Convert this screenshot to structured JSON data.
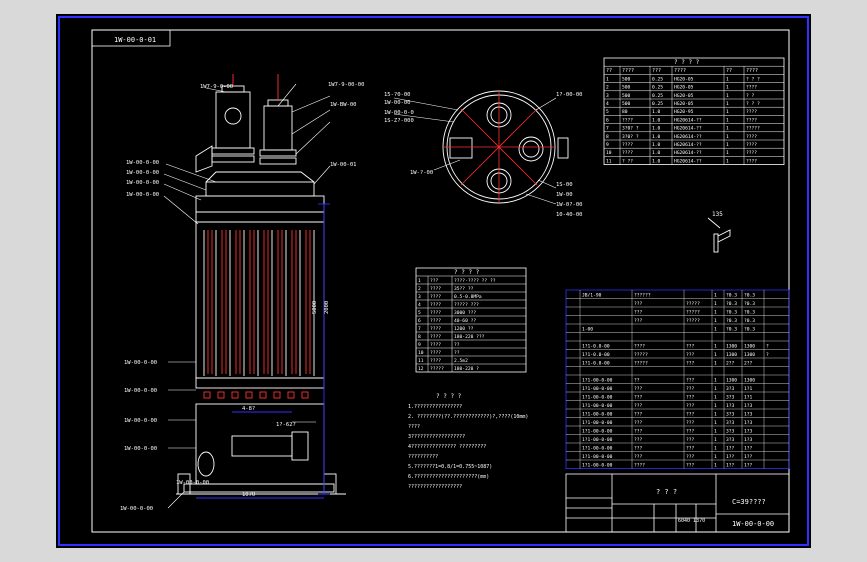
{
  "drawing": {
    "drawing_no_top": "1W-00-0-01",
    "drawing_no_bottom": "1W-00-0-00",
    "scale_label": "C=39????",
    "title_block_heading": "? ? ?",
    "small_box_label": "6040 1370",
    "view_label": "135"
  },
  "colors": {
    "background": "#000000",
    "frame": "#3030ff",
    "line": "#ffffff",
    "accent": "#ff3030",
    "dim": "#3030ff",
    "text": "#ffffff",
    "page": "#d9d9d9"
  },
  "side_view": {
    "labels": [
      "1W-00-0-00",
      "1W-00-0-00",
      "1W-00-0-00",
      "1W-00-0-00",
      "1W-00-0-00",
      "1W-00-0-00",
      "1W-00-0-00",
      "1W-00-0-00",
      "1W-00-0-00",
      "1W-00-0-00"
    ],
    "top_callouts": [
      "1W7-9-0-00",
      "1W7-9-00-00",
      "1W-BW-00",
      "1W-00-01"
    ],
    "dims": [
      "5000",
      "1070",
      "4-8?",
      "1?-62?",
      "2000"
    ]
  },
  "top_view": {
    "callouts": [
      "15-?0-00",
      "1W-00-00",
      "1W-00-0-0",
      "1S-Z?-000",
      "1?-00-00",
      "1W-?-00",
      "1S-00",
      "1W-00",
      "1W-0?-00",
      "10-40-00"
    ]
  },
  "nozzle_table": {
    "heading": "? ? ? ?",
    "columns": [
      "??",
      "????",
      "???",
      "????",
      "??",
      "????"
    ],
    "rows": [
      [
        "1",
        "500",
        "0.25",
        "HG20-05",
        "1",
        "? ? ?"
      ],
      [
        "2",
        "500",
        "0.25",
        "HG20-05",
        "1",
        "????"
      ],
      [
        "3",
        "500",
        "0.25",
        "HG20-05",
        "1",
        "? ?"
      ],
      [
        "4",
        "500",
        "0.25",
        "HG20-05",
        "1",
        "? ? ?"
      ],
      [
        "5",
        "80",
        "1.0",
        "HG20-95",
        "1",
        "????"
      ],
      [
        "6",
        "????",
        "1.0",
        "HG20614-??",
        "1",
        "????"
      ],
      [
        "7",
        "3?0? ?",
        "1.0",
        "HG20614-??",
        "1",
        "?????"
      ],
      [
        "8",
        "3?0? ?",
        "1.0",
        "HG20614-??",
        "1",
        "????"
      ],
      [
        "9",
        "????",
        "1.0",
        "HG20614-??",
        "1",
        "????"
      ],
      [
        "10",
        "????",
        "1.0",
        "HG20614-??",
        "1",
        "????"
      ],
      [
        "11",
        "? ??",
        "1.0",
        "HG20614-??",
        "1",
        "????"
      ]
    ]
  },
  "spec_table": {
    "heading": "? ? ? ?",
    "rows": [
      [
        "1",
        "???",
        "????-????  ??  ??"
      ],
      [
        "2",
        "????",
        "35??  ??"
      ],
      [
        "3",
        "????",
        "0.5-0.8MPa"
      ],
      [
        "4",
        "????",
        "?????  ???"
      ],
      [
        "5",
        "????",
        "3000  ???"
      ],
      [
        "6",
        "????",
        "40-60  ??"
      ],
      [
        "7",
        "????",
        "1200 ??"
      ],
      [
        "8",
        "????",
        "180-220  ???"
      ],
      [
        "9",
        "????",
        "??"
      ],
      [
        "10",
        "????",
        "??"
      ],
      [
        "11",
        "????",
        "2.5m2"
      ],
      [
        "12",
        "?????",
        "180-220  ?"
      ]
    ]
  },
  "tech_notes": {
    "heading": "? ? ? ?",
    "lines": [
      "1.????????????????",
      "2. ????????(??.????????????)?,????(10mm)",
      "   ????",
      "3??????????????????",
      "4??????????????? ?????????",
      "   ??????????",
      "5.???????1=0.8/1=0.755~1087)",
      "6.?????????????????????(mm)",
      "   ??????????????????"
    ]
  },
  "parts_list": {
    "rows": [
      [
        "",
        "JB/1-90",
        "??????",
        "",
        "1",
        "?0.3",
        "?0.3",
        ""
      ],
      [
        "",
        "",
        "???",
        "?????",
        "1",
        "?0.3",
        "?0.3",
        ""
      ],
      [
        "",
        "",
        "???",
        "?????",
        "1",
        "?0.3",
        "?0.3",
        ""
      ],
      [
        "",
        "",
        "???",
        "?????",
        "1",
        "?0.3",
        "?0.3",
        ""
      ],
      [
        "",
        "1-00",
        "",
        "",
        "1",
        "?0.3",
        "?0.3",
        ""
      ],
      [
        "",
        "",
        "",
        "",
        "",
        "",
        "",
        ""
      ],
      [
        "",
        "1?1-0.0-00",
        "????",
        "???",
        "1",
        "1300",
        "1300",
        "?"
      ],
      [
        "",
        "1?1-0.0-00",
        "?????",
        "???",
        "1",
        "1300",
        "1300",
        "?"
      ],
      [
        "",
        "1?1-0.0-00",
        "?????",
        "???",
        "1",
        "2??",
        "2??",
        ""
      ],
      [
        "",
        "",
        "",
        "",
        "",
        "",
        "",
        ""
      ],
      [
        "",
        "1?1-00-0-00",
        "??",
        "???",
        "1",
        "1300",
        "1300",
        ""
      ],
      [
        "",
        "1?1-00-0-00",
        "???",
        "???",
        "1",
        "3?3",
        "1?1",
        ""
      ],
      [
        "",
        "1?1-00-0-00",
        "???",
        "???",
        "1",
        "3?3",
        "1?1",
        ""
      ],
      [
        "",
        "1?1-00-0-00",
        "???",
        "???",
        "1",
        "1?3",
        "1?3",
        ""
      ],
      [
        "",
        "1?1-00-0-00",
        "???",
        "???",
        "1",
        "3?3",
        "1?3",
        ""
      ],
      [
        "",
        "1?1-00-0-00",
        "???",
        "???",
        "1",
        "3?3",
        "1?3",
        ""
      ],
      [
        "",
        "1?1-00-0-00",
        "???",
        "???",
        "1",
        "3?3",
        "1?3",
        ""
      ],
      [
        "",
        "1?1-00-0-00",
        "???",
        "???",
        "1",
        "3?3",
        "1?3",
        ""
      ],
      [
        "",
        "1?1-00-0-00",
        "???",
        "???",
        "1",
        "1??",
        "1??",
        ""
      ],
      [
        "",
        "1?1-00-0-00",
        "???",
        "???",
        "1",
        "1??",
        "1??",
        ""
      ],
      [
        "",
        "1?1-00-0-00",
        "????",
        "???",
        "1",
        "1??",
        "1??",
        ""
      ]
    ]
  }
}
